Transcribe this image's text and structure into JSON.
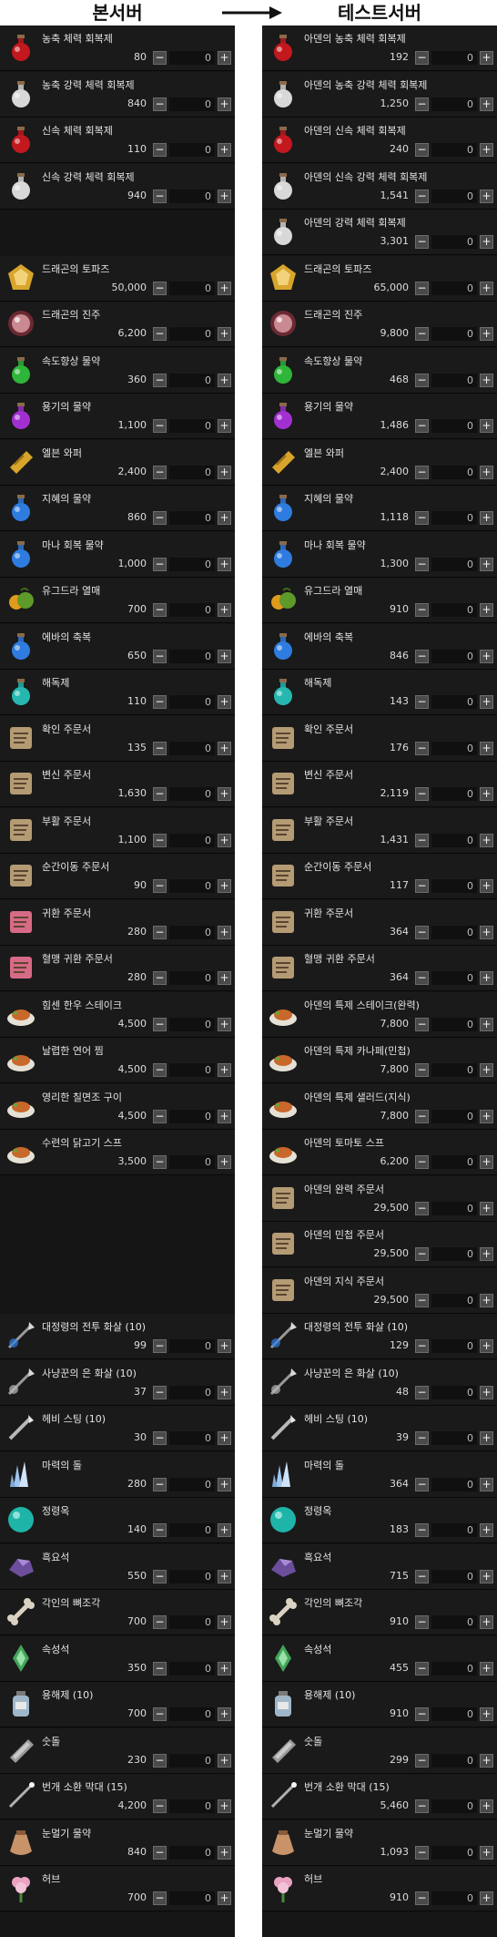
{
  "headers": {
    "left": "본서버",
    "right": "테스트서버"
  },
  "colors": {
    "flask-red": "#c2181e",
    "flask-white": "#d8d8d8",
    "flask-green": "#2fb53a",
    "flask-purple": "#a22fd0",
    "flask-blue": "#2f7ce0",
    "flask-cyan": "#26b8b0",
    "gold": "#d8a52c",
    "pearl": "#c98a92",
    "scroll": "#b49b74",
    "scroll-pink": "#d76a86",
    "food": "#c8682a",
    "arrow": "#b8b8b8",
    "crystal": "#9fc6f0",
    "orb": "#1fb4a8",
    "dark-stone": "#6c4e9c",
    "bone": "#d9d2c2",
    "attr-stone": "#43a55b",
    "jar": "#9fb6c8",
    "charcoal": "#9a9a9a",
    "wand": "#b0b0b0",
    "pouch": "#c9936a",
    "herb": "#e9a2c0"
  },
  "left": {
    "rows": [
      {
        "name": "농축 체력 회복제",
        "price": "80",
        "qty": "0",
        "icon": "potion-icon",
        "color": "flask-red"
      },
      {
        "name": "농축 강력 체력 회복제",
        "price": "840",
        "qty": "0",
        "icon": "potion-icon",
        "color": "flask-white"
      },
      {
        "name": "신속 체력 회복제",
        "price": "110",
        "qty": "0",
        "icon": "potion-icon",
        "color": "flask-red"
      },
      {
        "name": "신속 강력 체력 회복제",
        "price": "940",
        "qty": "0",
        "icon": "potion-icon",
        "color": "flask-white"
      },
      {
        "blank": true
      },
      {
        "name": "드래곤의 토파즈",
        "price": "50,000",
        "qty": "0",
        "icon": "topaz-icon",
        "color": "gold"
      },
      {
        "name": "드래곤의 진주",
        "price": "6,200",
        "qty": "0",
        "icon": "pearl-icon",
        "color": "pearl"
      },
      {
        "name": "속도향상 물약",
        "price": "360",
        "qty": "0",
        "icon": "potion-icon",
        "color": "flask-green"
      },
      {
        "name": "용기의 물약",
        "price": "1,100",
        "qty": "0",
        "icon": "potion-icon",
        "color": "flask-purple"
      },
      {
        "name": "엘븐 와퍼",
        "price": "2,400",
        "qty": "0",
        "icon": "wafer-icon",
        "color": "gold"
      },
      {
        "name": "지혜의 물약",
        "price": "860",
        "qty": "0",
        "icon": "potion-icon",
        "color": "flask-blue"
      },
      {
        "name": "마나 회복 물약",
        "price": "1,000",
        "qty": "0",
        "icon": "potion-icon",
        "color": "flask-blue"
      },
      {
        "name": "유그드라 열매",
        "price": "700",
        "qty": "0",
        "icon": "fruit-icon",
        "color": "gold"
      },
      {
        "name": "에바의 축복",
        "price": "650",
        "qty": "0",
        "icon": "potion-icon",
        "color": "flask-blue"
      },
      {
        "name": "해독제",
        "price": "110",
        "qty": "0",
        "icon": "potion-icon",
        "color": "flask-cyan"
      },
      {
        "name": "확인 주문서",
        "price": "135",
        "qty": "0",
        "icon": "scroll-icon",
        "color": "scroll"
      },
      {
        "name": "변신 주문서",
        "price": "1,630",
        "qty": "0",
        "icon": "scroll-icon",
        "color": "scroll"
      },
      {
        "name": "부활 주문서",
        "price": "1,100",
        "qty": "0",
        "icon": "scroll-icon",
        "color": "scroll"
      },
      {
        "name": "순간이동 주문서",
        "price": "90",
        "qty": "0",
        "icon": "scroll-icon",
        "color": "scroll"
      },
      {
        "name": "귀환 주문서",
        "price": "280",
        "qty": "0",
        "icon": "scroll-icon",
        "color": "scroll-pink"
      },
      {
        "name": "혈맹 귀환 주문서",
        "price": "280",
        "qty": "0",
        "icon": "scroll-icon",
        "color": "scroll-pink"
      },
      {
        "name": "힘센 한우 스테이크",
        "price": "4,500",
        "qty": "0",
        "icon": "food-icon",
        "color": "food"
      },
      {
        "name": "날렵한 연어 찜",
        "price": "4,500",
        "qty": "0",
        "icon": "food-icon",
        "color": "food"
      },
      {
        "name": "영리한 칠면조 구이",
        "price": "4,500",
        "qty": "0",
        "icon": "food-icon",
        "color": "food"
      },
      {
        "name": "수련의 닭고기 스프",
        "price": "3,500",
        "qty": "0",
        "icon": "food-icon",
        "color": "food"
      },
      {
        "blank": true
      },
      {
        "blank": true
      },
      {
        "blank": true
      },
      {
        "name": "대정령의 전투 화살 (10)",
        "price": "99",
        "qty": "0",
        "icon": "arrow-icon",
        "color": "flask-blue"
      },
      {
        "name": "사냥꾼의 은 화살 (10)",
        "price": "37",
        "qty": "0",
        "icon": "arrow-icon",
        "color": "arrow"
      },
      {
        "name": "헤비 스팅 (10)",
        "price": "30",
        "qty": "0",
        "icon": "sting-icon",
        "color": "arrow"
      },
      {
        "name": "마력의 돌",
        "price": "280",
        "qty": "0",
        "icon": "crystal-icon",
        "color": "crystal"
      },
      {
        "name": "정령옥",
        "price": "140",
        "qty": "0",
        "icon": "orb-icon",
        "color": "orb"
      },
      {
        "name": "흑요석",
        "price": "550",
        "qty": "0",
        "icon": "stone-icon",
        "color": "dark-stone"
      },
      {
        "name": "각인의 뼈조각",
        "price": "700",
        "qty": "0",
        "icon": "bone-icon",
        "color": "bone"
      },
      {
        "name": "속성석",
        "price": "350",
        "qty": "0",
        "icon": "gem-icon",
        "color": "attr-stone"
      },
      {
        "name": "용해제 (10)",
        "price": "700",
        "qty": "0",
        "icon": "jar-icon",
        "color": "jar"
      },
      {
        "name": "숫돌",
        "price": "230",
        "qty": "0",
        "icon": "whetstone-icon",
        "color": "charcoal"
      },
      {
        "name": "번개 소환 막대 (15)",
        "price": "4,200",
        "qty": "0",
        "icon": "wand-icon",
        "color": "wand"
      },
      {
        "name": "눈멀기 물약",
        "price": "840",
        "qty": "0",
        "icon": "pouch-icon",
        "color": "pouch"
      },
      {
        "name": "허브",
        "price": "700",
        "qty": "0",
        "icon": "herb-icon",
        "color": "herb"
      }
    ]
  },
  "right": {
    "rows": [
      {
        "name": "아덴의 농축 체력 회복제",
        "price": "192",
        "qty": "0",
        "icon": "potion-icon",
        "color": "flask-red"
      },
      {
        "name": "아덴의 농축 강력 체력 회복제",
        "price": "1,250",
        "qty": "0",
        "icon": "potion-icon",
        "color": "flask-white"
      },
      {
        "name": "아덴의 신속 체력 회복제",
        "price": "240",
        "qty": "0",
        "icon": "potion-icon",
        "color": "flask-red"
      },
      {
        "name": "아덴의 신속 강력 체력 회복제",
        "price": "1,541",
        "qty": "0",
        "icon": "potion-icon",
        "color": "flask-white"
      },
      {
        "name": "아덴의 강력 체력 회복제",
        "price": "3,301",
        "qty": "0",
        "icon": "potion-icon",
        "color": "flask-white"
      },
      {
        "name": "드래곤의 토파즈",
        "price": "65,000",
        "qty": "0",
        "icon": "topaz-icon",
        "color": "gold"
      },
      {
        "name": "드래곤의 진주",
        "price": "9,800",
        "qty": "0",
        "icon": "pearl-icon",
        "color": "pearl"
      },
      {
        "name": "속도향상 물약",
        "price": "468",
        "qty": "0",
        "icon": "potion-icon",
        "color": "flask-green"
      },
      {
        "name": "용기의 물약",
        "price": "1,486",
        "qty": "0",
        "icon": "potion-icon",
        "color": "flask-purple"
      },
      {
        "name": "엘븐 와퍼",
        "price": "2,400",
        "qty": "0",
        "icon": "wafer-icon",
        "color": "gold"
      },
      {
        "name": "지혜의 물약",
        "price": "1,118",
        "qty": "0",
        "icon": "potion-icon",
        "color": "flask-blue"
      },
      {
        "name": "마나 회복 물약",
        "price": "1,300",
        "qty": "0",
        "icon": "potion-icon",
        "color": "flask-blue"
      },
      {
        "name": "유그드라 열매",
        "price": "910",
        "qty": "0",
        "icon": "fruit-icon",
        "color": "gold"
      },
      {
        "name": "에바의 축복",
        "price": "846",
        "qty": "0",
        "icon": "potion-icon",
        "color": "flask-blue"
      },
      {
        "name": "해독제",
        "price": "143",
        "qty": "0",
        "icon": "potion-icon",
        "color": "flask-cyan"
      },
      {
        "name": "확인 주문서",
        "price": "176",
        "qty": "0",
        "icon": "scroll-icon",
        "color": "scroll"
      },
      {
        "name": "변신 주문서",
        "price": "2,119",
        "qty": "0",
        "icon": "scroll-icon",
        "color": "scroll"
      },
      {
        "name": "부활 주문서",
        "price": "1,431",
        "qty": "0",
        "icon": "scroll-icon",
        "color": "scroll"
      },
      {
        "name": "순간이동 주문서",
        "price": "117",
        "qty": "0",
        "icon": "scroll-icon",
        "color": "scroll"
      },
      {
        "name": "귀환 주문서",
        "price": "364",
        "qty": "0",
        "icon": "scroll-icon",
        "color": "scroll"
      },
      {
        "name": "혈맹 귀환 주문서",
        "price": "364",
        "qty": "0",
        "icon": "scroll-icon",
        "color": "scroll"
      },
      {
        "name": "아덴의 특제 스테이크(완력)",
        "price": "7,800",
        "qty": "0",
        "icon": "food-icon",
        "color": "food"
      },
      {
        "name": "아덴의 특제 카나페(민첩)",
        "price": "7,800",
        "qty": "0",
        "icon": "food-icon",
        "color": "food"
      },
      {
        "name": "아덴의 특제 샐러드(지식)",
        "price": "7,800",
        "qty": "0",
        "icon": "food-icon",
        "color": "food"
      },
      {
        "name": "아덴의 토마토 스프",
        "price": "6,200",
        "qty": "0",
        "icon": "food-icon",
        "color": "food"
      },
      {
        "name": "아덴의 완력 주문서",
        "price": "29,500",
        "qty": "0",
        "icon": "scroll-icon",
        "color": "scroll"
      },
      {
        "name": "아덴의 민첩 주문서",
        "price": "29,500",
        "qty": "0",
        "icon": "scroll-icon",
        "color": "scroll"
      },
      {
        "name": "아덴의 지식 주문서",
        "price": "29,500",
        "qty": "0",
        "icon": "scroll-icon",
        "color": "scroll"
      },
      {
        "name": "대정령의 전투 화살 (10)",
        "price": "129",
        "qty": "0",
        "icon": "arrow-icon",
        "color": "flask-blue"
      },
      {
        "name": "사냥꾼의 은 화살 (10)",
        "price": "48",
        "qty": "0",
        "icon": "arrow-icon",
        "color": "arrow"
      },
      {
        "name": "헤비 스팅 (10)",
        "price": "39",
        "qty": "0",
        "icon": "sting-icon",
        "color": "arrow"
      },
      {
        "name": "마력의 돌",
        "price": "364",
        "qty": "0",
        "icon": "crystal-icon",
        "color": "crystal"
      },
      {
        "name": "정령옥",
        "price": "183",
        "qty": "0",
        "icon": "orb-icon",
        "color": "orb"
      },
      {
        "name": "흑요석",
        "price": "715",
        "qty": "0",
        "icon": "stone-icon",
        "color": "dark-stone"
      },
      {
        "name": "각인의 뼈조각",
        "price": "910",
        "qty": "0",
        "icon": "bone-icon",
        "color": "bone"
      },
      {
        "name": "속성석",
        "price": "455",
        "qty": "0",
        "icon": "gem-icon",
        "color": "attr-stone"
      },
      {
        "name": "용해제 (10)",
        "price": "910",
        "qty": "0",
        "icon": "jar-icon",
        "color": "jar"
      },
      {
        "name": "숫돌",
        "price": "299",
        "qty": "0",
        "icon": "whetstone-icon",
        "color": "charcoal"
      },
      {
        "name": "번개 소환 막대 (15)",
        "price": "5,460",
        "qty": "0",
        "icon": "wand-icon",
        "color": "wand"
      },
      {
        "name": "눈멀기 물약",
        "price": "1,093",
        "qty": "0",
        "icon": "pouch-icon",
        "color": "pouch"
      },
      {
        "name": "허브",
        "price": "910",
        "qty": "0",
        "icon": "herb-icon",
        "color": "herb"
      }
    ]
  },
  "buttons": {
    "minus": "−",
    "plus": "+"
  }
}
